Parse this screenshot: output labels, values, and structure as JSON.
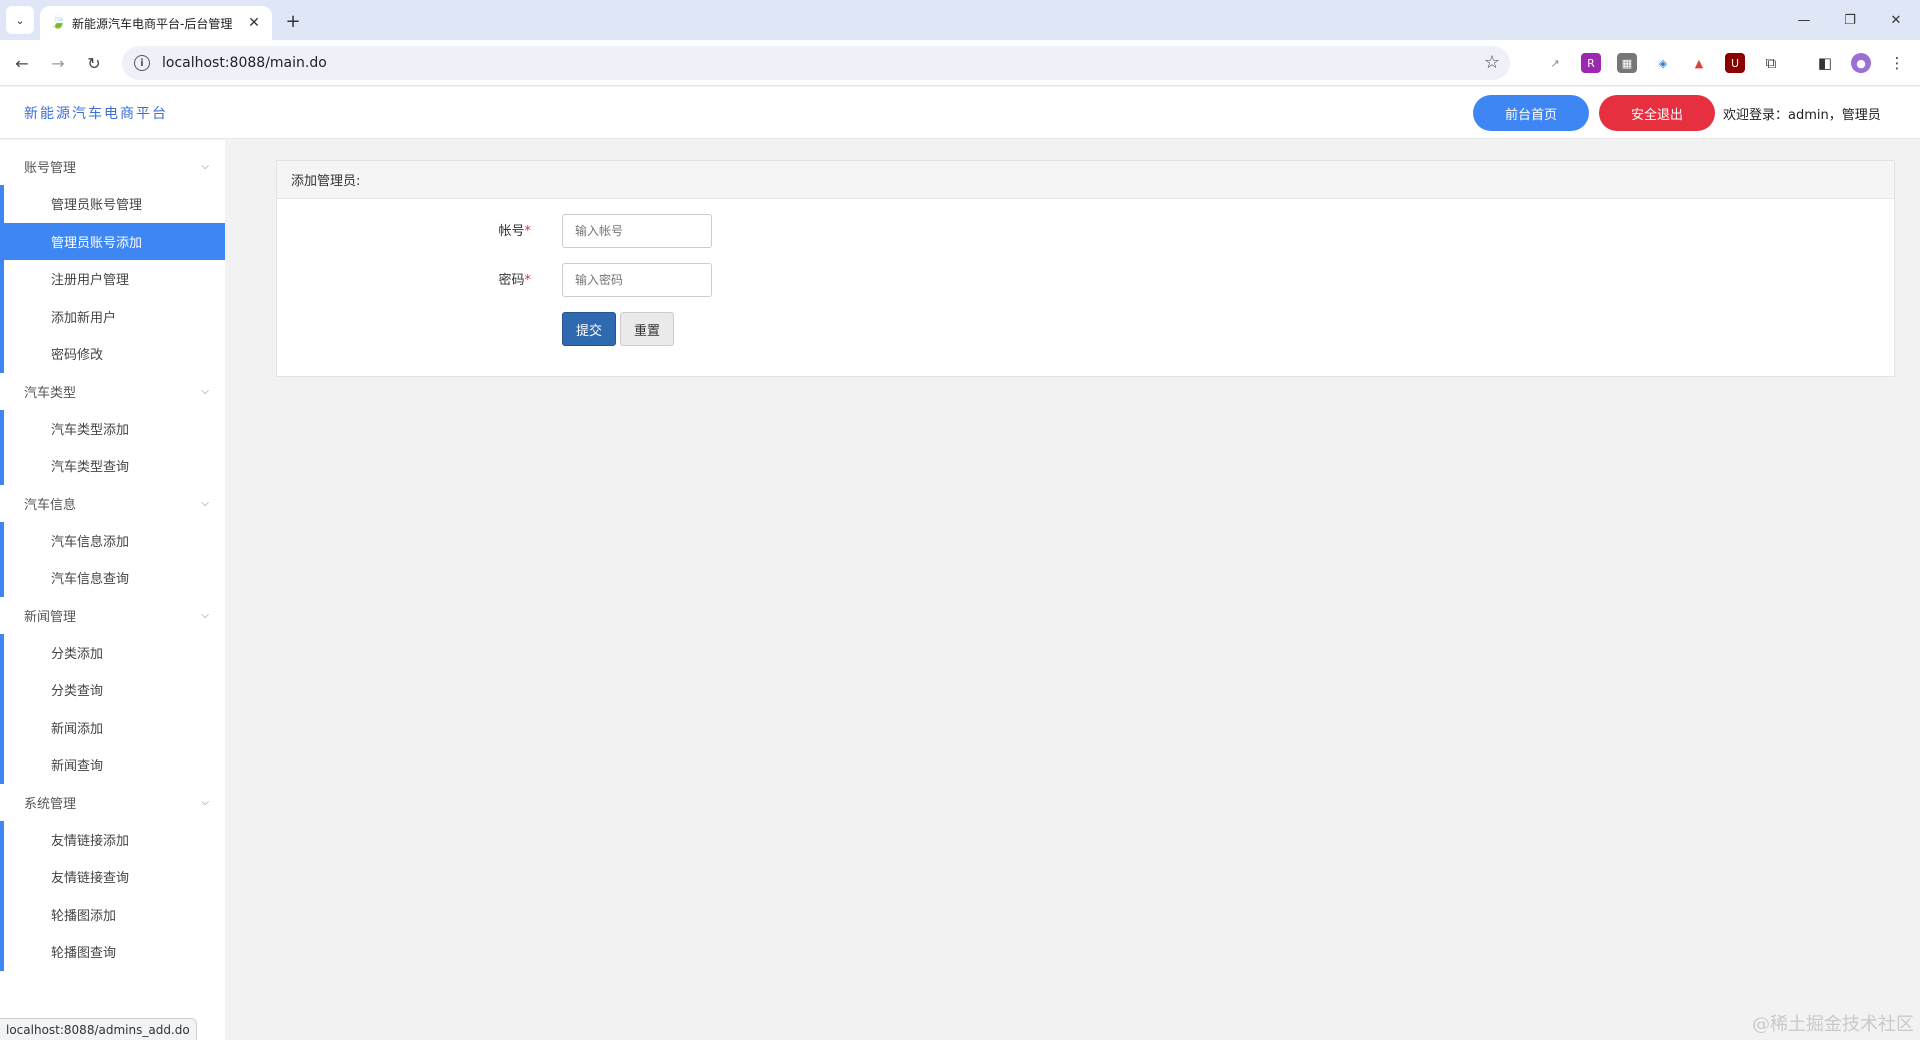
{
  "browser": {
    "tab_title": "新能源汽车电商平台-后台管理",
    "url": "localhost:8088/main.do",
    "status_url": "localhost:8088/admins_add.do"
  },
  "header": {
    "app_title": "新能源汽车电商平台",
    "front_button": "前台首页",
    "logout_button": "安全退出",
    "welcome": "欢迎登录：admin，管理员"
  },
  "sidebar": {
    "groups": [
      {
        "label": "账号管理",
        "items": [
          "管理员账号管理",
          "管理员账号添加",
          "注册用户管理",
          "添加新用户",
          "密码修改"
        ]
      },
      {
        "label": "汽车类型",
        "items": [
          "汽车类型添加",
          "汽车类型查询"
        ]
      },
      {
        "label": "汽车信息",
        "items": [
          "汽车信息添加",
          "汽车信息查询"
        ]
      },
      {
        "label": "新闻管理",
        "items": [
          "分类添加",
          "分类查询",
          "新闻添加",
          "新闻查询"
        ]
      },
      {
        "label": "系统管理",
        "items": [
          "友情链接添加",
          "友情链接查询",
          "轮播图添加",
          "轮播图查询"
        ]
      }
    ],
    "active_item": "管理员账号添加"
  },
  "form": {
    "title": "添加管理员:",
    "account_label": "帐号",
    "account_placeholder": "输入帐号",
    "password_label": "密码",
    "password_placeholder": "输入密码",
    "required_mark": "*",
    "submit_label": "提交",
    "reset_label": "重置"
  },
  "watermark": "@稀土掘金技术社区",
  "colors": {
    "accent": "#3d86f4",
    "danger": "#e7303f",
    "submit": "#2f6ab0"
  }
}
